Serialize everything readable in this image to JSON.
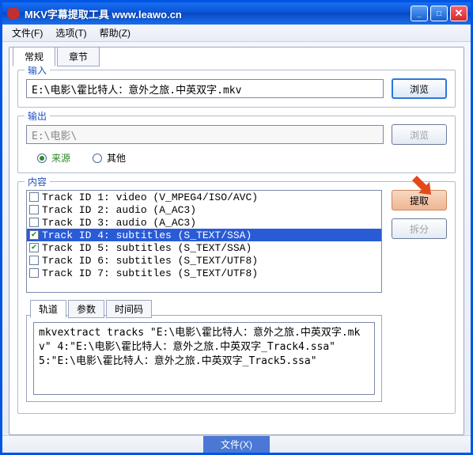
{
  "titlebar": {
    "title": "MKV字幕提取工具  www.leawo.cn"
  },
  "win_controls": {
    "min": "_",
    "max": "□",
    "close": "✕"
  },
  "menu": {
    "file": "文件(F)",
    "options": "选项(T)",
    "help": "帮助(Z)"
  },
  "main_tabs": {
    "general": "常规",
    "chapters": "章节"
  },
  "input": {
    "label": "输入",
    "path": "E:\\电影\\霍比特人：意外之旅.中英双字.mkv",
    "browse": "浏览"
  },
  "output": {
    "label": "输出",
    "path": "E:\\电影\\",
    "browse": "浏览",
    "radio_source": "来源",
    "radio_other": "其他"
  },
  "content": {
    "label": "内容",
    "extract": "提取",
    "split": "拆分",
    "tracks": [
      {
        "checked": false,
        "text": "Track ID 1: video (V_MPEG4/ISO/AVC)"
      },
      {
        "checked": false,
        "text": "Track ID 2: audio (A_AC3)"
      },
      {
        "checked": false,
        "text": "Track ID 3: audio (A_AC3)"
      },
      {
        "checked": true,
        "text": "Track ID 4: subtitles (S_TEXT/SSA)",
        "selected": true
      },
      {
        "checked": true,
        "text": "Track ID 5: subtitles (S_TEXT/SSA)"
      },
      {
        "checked": false,
        "text": "Track ID 6: subtitles (S_TEXT/UTF8)"
      },
      {
        "checked": false,
        "text": "Track ID 7: subtitles (S_TEXT/UTF8)"
      }
    ],
    "sub_tabs": {
      "track": "轨道",
      "params": "参数",
      "timecode": "时间码"
    },
    "command": "mkvextract tracks \"E:\\电影\\霍比特人：意外之旅.中英双字.mkv\" 4:\"E:\\电影\\霍比特人：意外之旅.中英双字_Track4.ssa\" 5:\"E:\\电影\\霍比特人：意外之旅.中英双字_Track5.ssa\""
  },
  "statusbar": {
    "file": "文件(X)"
  }
}
